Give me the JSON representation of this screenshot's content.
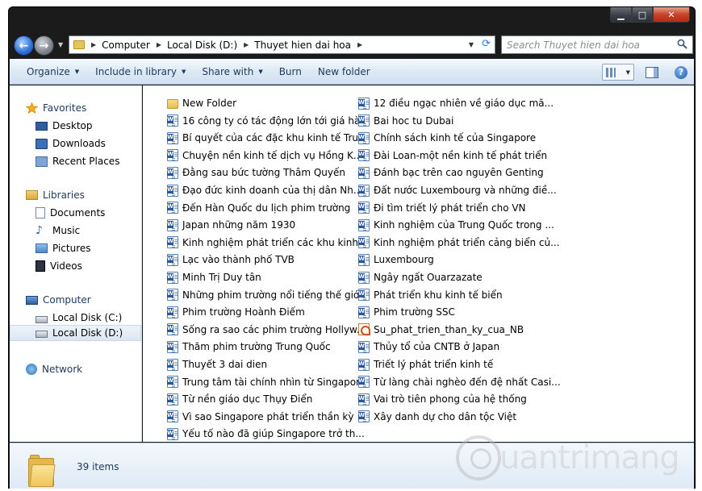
{
  "window": {
    "caption": {
      "minimize": "▁",
      "maximize": "□",
      "close": "✕"
    }
  },
  "navigation": {
    "back_glyph": "←",
    "forward_glyph": "→",
    "breadcrumb": [
      "Computer",
      "Local Disk (D:)",
      "Thuyet hien dai hoa"
    ],
    "search_placeholder": "Search Thuyet hien dai hoa"
  },
  "toolbar": {
    "organize": "Organize",
    "include_in_library": "Include in library",
    "share_with": "Share with",
    "burn": "Burn",
    "new_folder": "New folder",
    "help": "?"
  },
  "nav_pane": {
    "favorites": {
      "label": "Favorites",
      "items": [
        "Desktop",
        "Downloads",
        "Recent Places"
      ]
    },
    "libraries": {
      "label": "Libraries",
      "items": [
        "Documents",
        "Music",
        "Pictures",
        "Videos"
      ]
    },
    "computer": {
      "label": "Computer",
      "items": [
        "Local Disk (C:)",
        "Local Disk (D:)"
      ],
      "selected": "Local Disk (D:)"
    },
    "network": {
      "label": "Network"
    }
  },
  "files": {
    "column1": [
      {
        "name": "New Folder",
        "type": "folder"
      },
      {
        "name": "16 công ty có tác động lớn tới giá hà...",
        "type": "word"
      },
      {
        "name": "Bí quyết của các đặc khu kinh tế Tru...",
        "type": "word"
      },
      {
        "name": "Chuyện nền kinh tế dịch vụ Hồng K...",
        "type": "word"
      },
      {
        "name": "Đằng sau bức tường Thâm Quyến",
        "type": "word"
      },
      {
        "name": "Đạo đức kinh doanh của thị dân Nh...",
        "type": "word"
      },
      {
        "name": "Đến Hàn Quốc du lịch phim trường",
        "type": "word"
      },
      {
        "name": "Japan những năm 1930",
        "type": "word"
      },
      {
        "name": "Kinh nghiệm phát triển các khu kinh...",
        "type": "word"
      },
      {
        "name": "Lạc vào thành phố TVB",
        "type": "word"
      },
      {
        "name": "Minh Trị Duy tân",
        "type": "word"
      },
      {
        "name": "Những phim trường nổi tiếng thế giới",
        "type": "word"
      },
      {
        "name": "Phim trường Hoành Điếm",
        "type": "word"
      },
      {
        "name": "Sống ra sao các phim trường Hollyw...",
        "type": "word"
      },
      {
        "name": "Thăm phim trường Trung Quốc",
        "type": "word"
      },
      {
        "name": "Thuyết 3 dai dien",
        "type": "word"
      },
      {
        "name": "Trung tâm tài chính nhìn từ Singapore",
        "type": "word"
      },
      {
        "name": "Từ nền giáo dục Thụy Điển",
        "type": "word"
      },
      {
        "name": "Vì sao Singapore phát triển thần kỳ",
        "type": "word"
      },
      {
        "name": "Yếu tố nào đã giúp Singapore trở th...",
        "type": "word"
      }
    ],
    "column2": [
      {
        "name": "12 điều ngạc nhiên về giáo dục mã...",
        "type": "word"
      },
      {
        "name": "Bai hoc tu Dubai",
        "type": "word"
      },
      {
        "name": "Chính sách kinh tế của Singapore",
        "type": "word"
      },
      {
        "name": "Đài Loan-một nền kinh tế phát triển",
        "type": "word"
      },
      {
        "name": "Đánh bạc trên cao nguyên Genting",
        "type": "word"
      },
      {
        "name": "Đất nước Luxembourg và những điề...",
        "type": "word"
      },
      {
        "name": "Đi tìm triết lý phát triển cho VN",
        "type": "word"
      },
      {
        "name": "Kinh nghiệm của Trung Quốc trong ...",
        "type": "word"
      },
      {
        "name": "Kinh nghiệm phát triển cảng biển củ...",
        "type": "word"
      },
      {
        "name": "Luxembourg",
        "type": "word"
      },
      {
        "name": "Ngây ngất Ouarzazate",
        "type": "word"
      },
      {
        "name": "Phát triển khu kinh tế biển",
        "type": "word"
      },
      {
        "name": "Phim trường SSC",
        "type": "word"
      },
      {
        "name": "Su_phat_trien_than_ky_cua_NB",
        "type": "pdf"
      },
      {
        "name": "Thủy tổ của CNTB ở Japan",
        "type": "word"
      },
      {
        "name": "Triết lý phát triển kinh tế",
        "type": "word"
      },
      {
        "name": "Từ làng chài nghèo đến đệ nhất Casi...",
        "type": "word"
      },
      {
        "name": "Vai trò tiên phong của hệ thống",
        "type": "word"
      },
      {
        "name": "Xây danh dự cho dân tộc Việt",
        "type": "word"
      }
    ]
  },
  "status": {
    "count": "39 items"
  },
  "watermark": {
    "text": "uantrimang"
  }
}
